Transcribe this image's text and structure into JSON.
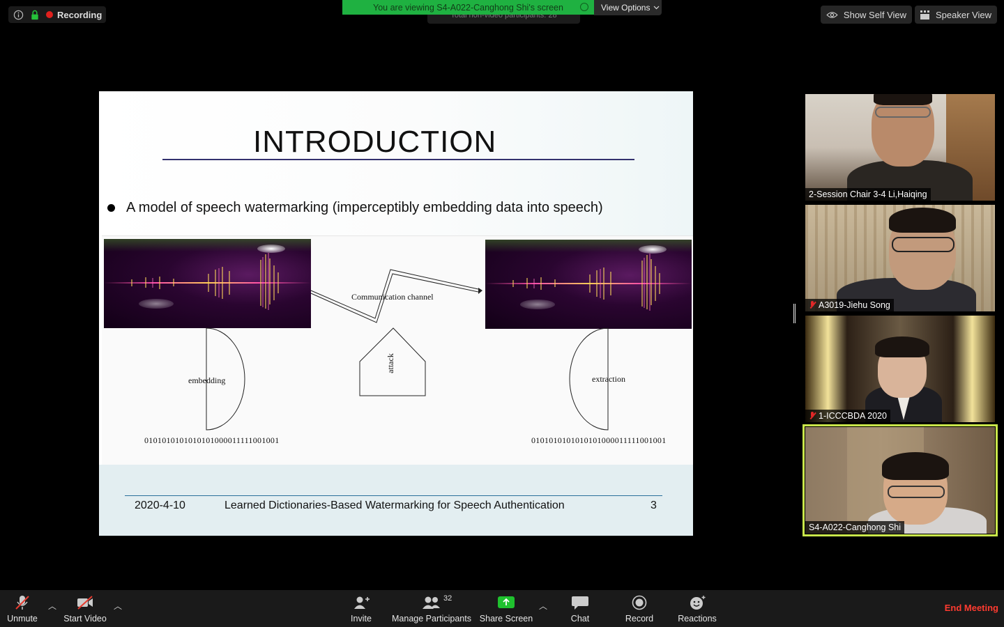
{
  "topbar": {
    "recording_label": "Recording",
    "banner_text": "You are viewing S4-A022-Canghong Shi's screen",
    "ghost_text": "Total non-video participants: 28",
    "view_options_label": "View Options",
    "show_self_view_label": "Show Self View",
    "speaker_view_label": "Speaker View"
  },
  "slide": {
    "title": "INTRODUCTION",
    "bullet": "A model of speech watermarking (imperceptibly embedding data into speech)",
    "diagram": {
      "channel_label": "Communication channel",
      "embedding_label": "embedding",
      "attack_label": "attack",
      "extraction_label": "extraction",
      "binary_left": "0101010101010101000011111001001",
      "binary_right": "0101010101010101000011111001001"
    },
    "footer": {
      "date": "2020-4-10",
      "title": "Learned Dictionaries-Based Watermarking for Speech Authentication",
      "page": "3"
    }
  },
  "participants": [
    {
      "name": "2-Session Chair 3-4 Li,Haiqing",
      "muted": false,
      "active": false
    },
    {
      "name": "A3019-Jiehu Song",
      "muted": true,
      "active": false
    },
    {
      "name": "1-ICCCBDA 2020",
      "muted": true,
      "active": false
    },
    {
      "name": "S4-A022-Canghong Shi",
      "muted": false,
      "active": true
    }
  ],
  "toolbar": {
    "unmute_label": "Unmute",
    "start_video_label": "Start Video",
    "invite_label": "Invite",
    "manage_participants_label": "Manage Participants",
    "participant_count": "32",
    "share_screen_label": "Share Screen",
    "chat_label": "Chat",
    "record_label": "Record",
    "reactions_label": "Reactions",
    "end_meeting_label": "End Meeting"
  },
  "colors": {
    "banner_green": "#1fb141",
    "active_speaker_outline": "#c9e64a",
    "end_meeting_red": "#ff3b30",
    "share_screen_green": "#1fc12e",
    "title_rule": "#33316e"
  }
}
